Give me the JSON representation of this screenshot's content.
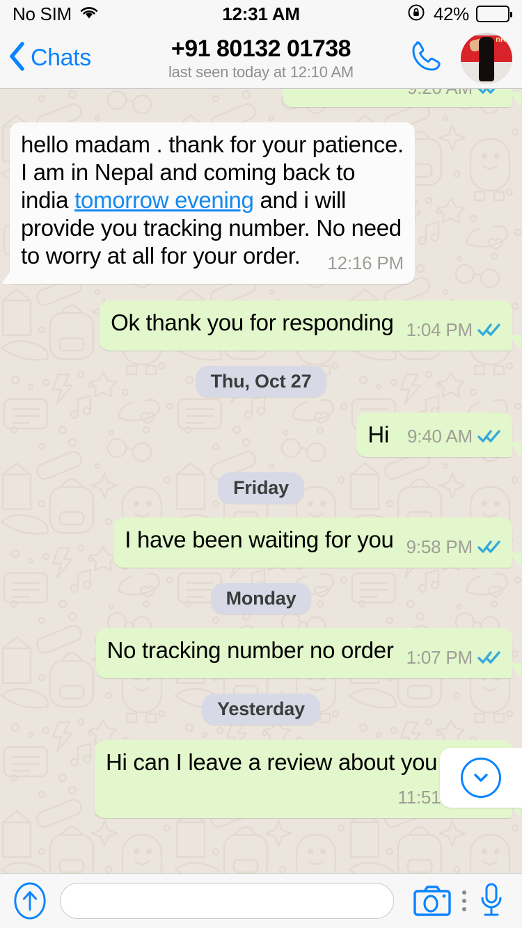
{
  "status_bar": {
    "carrier": "No SIM",
    "wifi_icon": "wifi-icon",
    "time": "12:31 AM",
    "rotation_lock_icon": "rotation-lock-icon",
    "battery_percent": "42%",
    "battery_level": 42
  },
  "nav": {
    "back_label": "Chats",
    "back_icon": "chevron-left-icon",
    "title": "+91 80132 01738",
    "subtitle": "last seen today at 12:10 AM",
    "call_icon": "phone-call-icon",
    "avatar_label": "contact-avatar",
    "avatar_text": "nKa"
  },
  "colors": {
    "ios_blue": "#0A84FF",
    "outgoing_bubble": "#E2F7CB",
    "incoming_bubble": "#FBFBFB",
    "chat_background": "#ECE5DD",
    "date_pill": "#D7DAE6",
    "tick_blue": "#34AADC",
    "meta_gray": "#9E9E96",
    "link_blue": "#1389F0"
  },
  "chat": {
    "scroll_button_icon": "chevron-down-icon",
    "messages": [
      {
        "id": "m0",
        "kind": "bubble",
        "side": "out",
        "clipped": true,
        "text": "",
        "time": "9:20 AM",
        "ticks": "read"
      },
      {
        "id": "m1",
        "kind": "bubble",
        "side": "in",
        "text_before_link": "hello madam . thank for your patience. I am in Nepal and coming back to india ",
        "link_text": "tomorrow evening",
        "text_after_link": " and i will provide you tracking number. No need to worry at all for your order.",
        "time": "12:16 PM",
        "ticks": "none"
      },
      {
        "id": "m2",
        "kind": "bubble",
        "side": "out",
        "text": "Ok thank you for responding",
        "time": "1:04 PM",
        "ticks": "read"
      },
      {
        "id": "d1",
        "kind": "divider",
        "label": "Thu, Oct 27"
      },
      {
        "id": "m3",
        "kind": "bubble",
        "side": "out",
        "inline_meta": true,
        "text": "Hi",
        "time": "9:40 AM",
        "ticks": "read"
      },
      {
        "id": "d2",
        "kind": "divider",
        "label": "Friday"
      },
      {
        "id": "m4",
        "kind": "bubble",
        "side": "out",
        "text": "I have been waiting for you",
        "time": "9:58 PM",
        "ticks": "read"
      },
      {
        "id": "d3",
        "kind": "divider",
        "label": "Monday"
      },
      {
        "id": "m5",
        "kind": "bubble",
        "side": "out",
        "text": "No tracking number no order",
        "time": "1:07 PM",
        "ticks": "read"
      },
      {
        "id": "d4",
        "kind": "divider",
        "label": "Yesterday"
      },
      {
        "id": "m6",
        "kind": "bubble",
        "side": "out",
        "text": "Hi can I leave a review about you",
        "time": "11:51 PM",
        "ticks": "read"
      }
    ]
  },
  "input_bar": {
    "attach_icon": "arrow-up-circle-icon",
    "message_value": "",
    "message_placeholder": "",
    "camera_icon": "camera-icon",
    "more_icon": "more-options-icon",
    "mic_icon": "microphone-icon"
  }
}
